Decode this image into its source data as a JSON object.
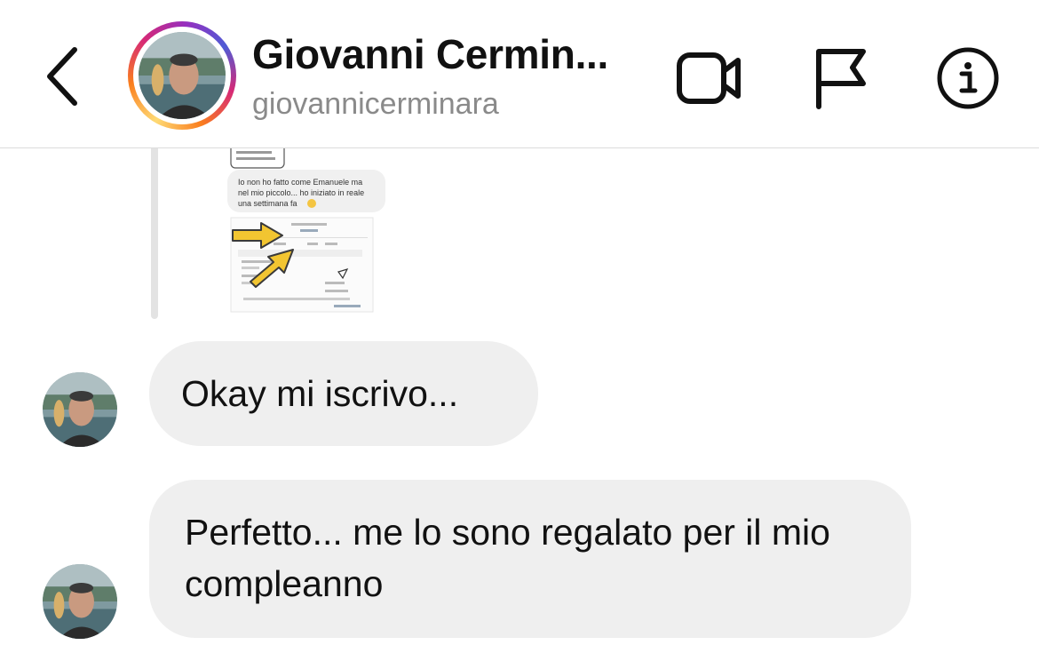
{
  "header": {
    "back_icon": "chevron-left-icon",
    "display_name": "Giovanni Cermin...",
    "username": "giovannicerminara",
    "has_story_ring": true,
    "actions": [
      {
        "icon": "video-call-icon"
      },
      {
        "icon": "flag-icon"
      },
      {
        "icon": "info-icon"
      }
    ]
  },
  "shared_post": {
    "text_line_1": "Io non ho fatto come Emanuele ma",
    "text_line_2": "nel mio piccolo... ho iniziato in reale",
    "text_line_3": "una settimana fa",
    "emoji": "😅",
    "arrow_color": "#f2c531"
  },
  "messages": [
    {
      "sender": "giovannicerminara",
      "text": "Okay mi iscrivo..."
    },
    {
      "sender": "giovannicerminara",
      "text": "Perfetto... me lo sono regalato per il mio compleanno"
    }
  ],
  "colors": {
    "bubble_bg": "#efefef",
    "handle_gray": "#8a8a8a",
    "divider": "#dcdcdc"
  }
}
